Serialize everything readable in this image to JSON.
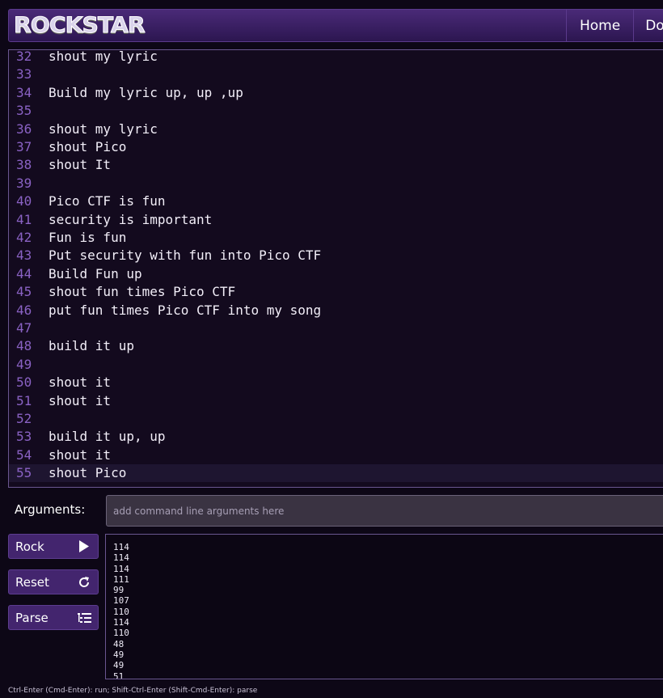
{
  "header": {
    "logo_text": "ROCKSTAR",
    "nav": [
      "Home",
      "Do"
    ]
  },
  "editor": {
    "lines": [
      {
        "n": "32",
        "text": "shout my lyric"
      },
      {
        "n": "33",
        "text": ""
      },
      {
        "n": "34",
        "text": "Build my lyric up, up ,up"
      },
      {
        "n": "35",
        "text": ""
      },
      {
        "n": "36",
        "text": "shout my lyric"
      },
      {
        "n": "37",
        "text": "shout Pico"
      },
      {
        "n": "38",
        "text": "shout It"
      },
      {
        "n": "39",
        "text": ""
      },
      {
        "n": "40",
        "text": "Pico CTF is fun"
      },
      {
        "n": "41",
        "text": "security is important"
      },
      {
        "n": "42",
        "text": "Fun is fun"
      },
      {
        "n": "43",
        "text": "Put security with fun into Pico CTF"
      },
      {
        "n": "44",
        "text": "Build Fun up"
      },
      {
        "n": "45",
        "text": "shout fun times Pico CTF"
      },
      {
        "n": "46",
        "text": "put fun times Pico CTF into my song"
      },
      {
        "n": "47",
        "text": ""
      },
      {
        "n": "48",
        "text": "build it up"
      },
      {
        "n": "49",
        "text": ""
      },
      {
        "n": "50",
        "text": "shout it"
      },
      {
        "n": "51",
        "text": "shout it"
      },
      {
        "n": "52",
        "text": ""
      },
      {
        "n": "53",
        "text": "build it up, up"
      },
      {
        "n": "54",
        "text": "shout it"
      },
      {
        "n": "55",
        "text": "shout Pico"
      }
    ],
    "active_line": "55"
  },
  "arguments": {
    "label": "Arguments:",
    "placeholder": "add command line arguments here",
    "value": ""
  },
  "buttons": {
    "rock": {
      "label": "Rock",
      "icon": "play-icon"
    },
    "reset": {
      "label": "Reset",
      "icon": "refresh-icon"
    },
    "parse": {
      "label": "Parse",
      "icon": "list-tree-icon"
    }
  },
  "output": {
    "lines": [
      "114",
      "114",
      "114",
      "111",
      "99",
      "107",
      "110",
      "114",
      "110",
      "48",
      "49",
      "49",
      "51"
    ]
  },
  "hint": "Ctrl-Enter (Cmd-Enter): run; Shift-Ctrl-Enter (Shift-Cmd-Enter): parse",
  "colors": {
    "background": "#0d0716",
    "header": "#3b1f66",
    "accent": "#43256e",
    "line_number": "#8a62c4"
  }
}
